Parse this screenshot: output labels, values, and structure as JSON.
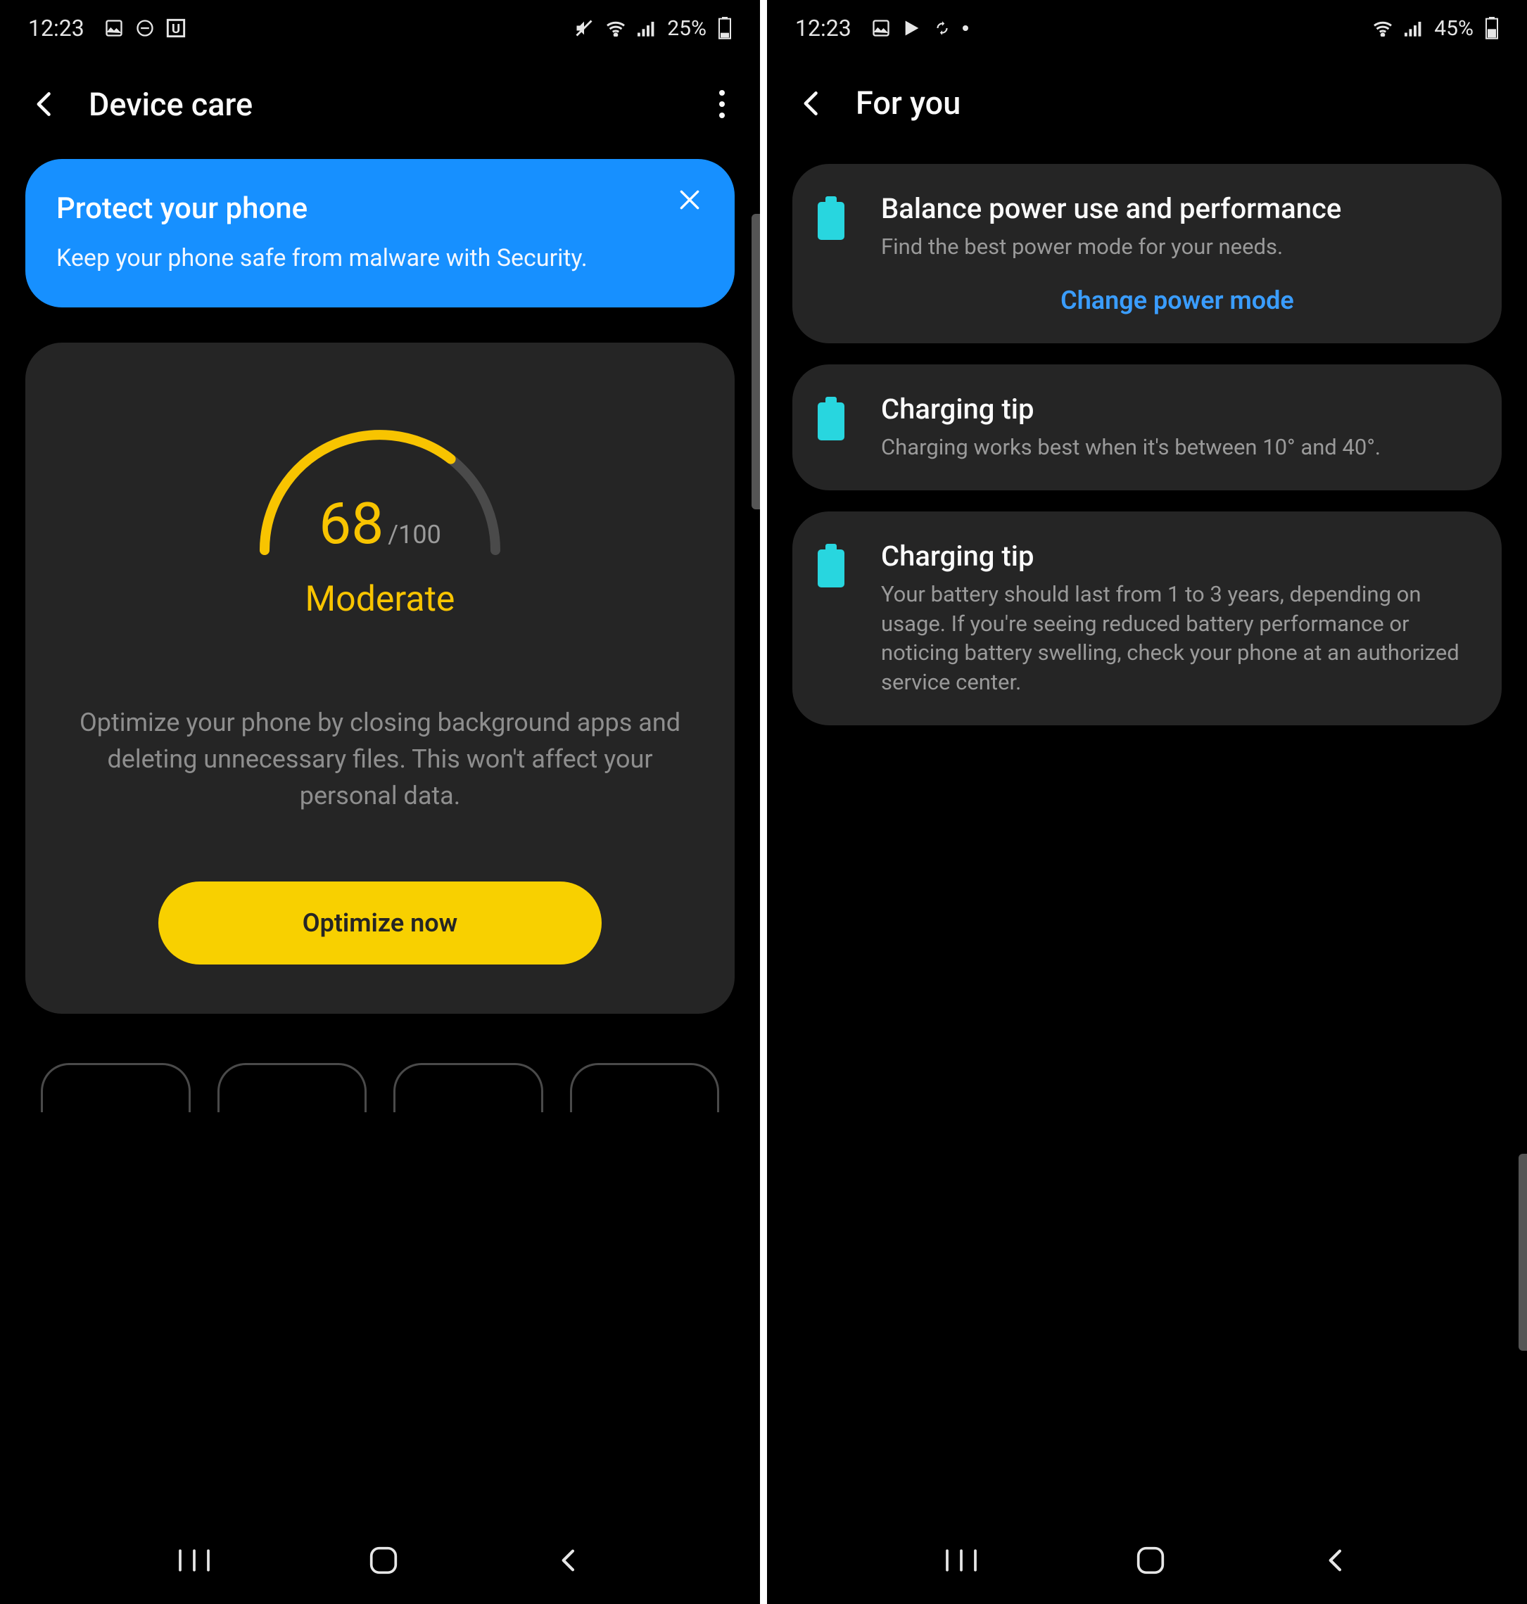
{
  "left": {
    "status": {
      "time": "12:23",
      "battery_text": "25%"
    },
    "header": {
      "title": "Device care"
    },
    "banner": {
      "title": "Protect your phone",
      "desc": "Keep your phone safe from malware with Security."
    },
    "gauge": {
      "score": "68",
      "total": "/100",
      "label": "Moderate",
      "percent": 68
    },
    "optimize_desc": "Optimize your phone by closing background apps and deleting unnecessary files. This won't affect your personal data.",
    "optimize_btn": "Optimize now"
  },
  "right": {
    "status": {
      "time": "12:23",
      "battery_text": "45%"
    },
    "header": {
      "title": "For you"
    },
    "cards": [
      {
        "title": "Balance power use and performance",
        "desc": "Find the best power mode for your needs.",
        "action": "Change power mode"
      },
      {
        "title": "Charging tip",
        "desc": "Charging works best when it's between 10° and 40°."
      },
      {
        "title": "Charging tip",
        "desc": "Your battery should last from 1 to 3 years, depending on usage. If you're seeing reduced battery performance or noticing battery swelling, check your phone at an authorized service center."
      }
    ]
  }
}
